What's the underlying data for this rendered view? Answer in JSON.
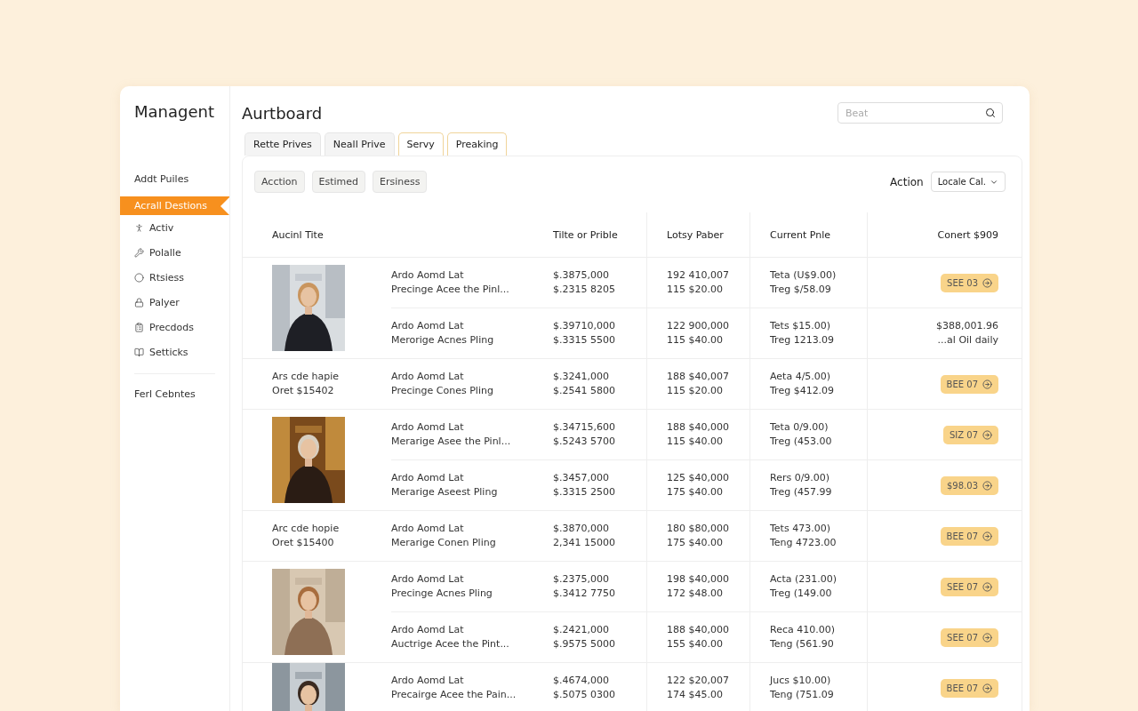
{
  "sidebar": {
    "title": "Managent",
    "items": [
      {
        "label": "Addt Puiles",
        "kind": "text",
        "selected": false
      },
      {
        "label": "Acrall Destions",
        "kind": "text",
        "selected": true
      },
      {
        "label": "Activ",
        "kind": "icon",
        "selected": false
      },
      {
        "label": "Polalle",
        "kind": "icon",
        "selected": false
      },
      {
        "label": "Rtsiess",
        "kind": "icon",
        "selected": false
      },
      {
        "label": "Palyer",
        "kind": "icon",
        "selected": false
      },
      {
        "label": "Precdods",
        "kind": "icon",
        "selected": false
      },
      {
        "label": "Setticks",
        "kind": "icon",
        "selected": false
      }
    ],
    "footer_items": [
      "Ferl Cebntes"
    ]
  },
  "header": {
    "title": "Aurtboard",
    "search": {
      "placeholder": "Beat"
    }
  },
  "tabs": [
    {
      "label": "Rette Prives",
      "selected": false
    },
    {
      "label": "Neall Prive",
      "selected": false
    },
    {
      "label": "Servy",
      "selected": true
    },
    {
      "label": "Preaking",
      "selected": true
    }
  ],
  "filters": [
    "Acction",
    "Estimed",
    "Ersiness"
  ],
  "action_label": "Action",
  "action_select": "Locale Cal.",
  "table": {
    "columns": [
      "Aucinl Tite",
      "Tilte or Prible",
      "Lotsy Paber",
      "Current Pnle",
      "Conert $909"
    ],
    "groups": [
      {
        "lot": {
          "kind": "picture"
        },
        "rows": [
          {
            "title": [
              "Ardo Aomd Lat",
              "Precinge Acee the Pinl..."
            ],
            "price": [
              "$.3875,000",
              "$.2315 8205"
            ],
            "lot_price": [
              "192 410,007",
              "115 $20.00"
            ],
            "current": [
              "Teta (U$9.00)",
              "Treg $/58.09"
            ],
            "action": {
              "kind": "button",
              "label": "SEE 03"
            }
          },
          {
            "title": [
              "Ardo Aomd Lat",
              "Merorige Acnes Pling"
            ],
            "price": [
              "$.39710,000",
              "$.3315 5500"
            ],
            "lot_price": [
              "122 900,000",
              "115 $40.00"
            ],
            "current": [
              "Tets $15.00)",
              "Treg 1213.09"
            ],
            "action": {
              "kind": "price",
              "lines": [
                "$388,001.96",
                "...al Oil daily"
              ]
            }
          }
        ]
      },
      {
        "lot": {
          "kind": "text",
          "lines": [
            "Ars cde hapie",
            "Oret $15402"
          ]
        },
        "rows": [
          {
            "title": [
              "Ardo Aomd Lat",
              "Precinge Cones Pling"
            ],
            "price": [
              "$.3241,000",
              "$.2541 5800"
            ],
            "lot_price": [
              "188 $40,007",
              "115 $20.00"
            ],
            "current": [
              "Aeta 4/5.00)",
              "Treg $412.09"
            ],
            "action": {
              "kind": "button",
              "label": "BEE 07"
            }
          }
        ]
      },
      {
        "lot": {
          "kind": "picture"
        },
        "rows": [
          {
            "title": [
              "Ardo Aomd Lat",
              "Merarige Asee the Pinl..."
            ],
            "price": [
              "$.34715,600",
              "$.5243 5700"
            ],
            "lot_price": [
              "188 $40,000",
              "115 $40.00"
            ],
            "current": [
              "Teta 0/9.00)",
              "Treg (453.00"
            ],
            "action": {
              "kind": "button",
              "label": "SIZ 07"
            }
          },
          {
            "title": [
              "Ardo Aomd Lat",
              "Merarige Aseest Pling"
            ],
            "price": [
              "$.3457,000",
              "$.3315 2500"
            ],
            "lot_price": [
              "125 $40,000",
              "175 $40.00"
            ],
            "current": [
              "Rers 0/9.00)",
              "Treg (457.99"
            ],
            "action": {
              "kind": "button",
              "label": "$98.03"
            }
          }
        ]
      },
      {
        "lot": {
          "kind": "text",
          "lines": [
            "Arc cde hopie",
            "Oret $15400"
          ]
        },
        "rows": [
          {
            "title": [
              "Ardo Aomd Lat",
              "Merarige Conen Pling"
            ],
            "price": [
              "$.3870,000",
              "2,341 15000"
            ],
            "lot_price": [
              "180 $80,000",
              "175 $40.00"
            ],
            "current": [
              "Tets 473.00)",
              "Teng 4723.00"
            ],
            "action": {
              "kind": "button",
              "label": "BEE 07"
            }
          }
        ]
      },
      {
        "lot": {
          "kind": "picture"
        },
        "rows": [
          {
            "title": [
              "Ardo Aomd Lat",
              "Precinge Acnes Pling"
            ],
            "price": [
              "$.2375,000",
              "$.3412 7750"
            ],
            "lot_price": [
              "198 $40,000",
              "172 $48.00"
            ],
            "current": [
              "Acta (231.00)",
              "Treg (149.00"
            ],
            "action": {
              "kind": "button",
              "label": "SEE 07"
            }
          },
          {
            "title": [
              "Ardo Aomd Lat",
              "Auctrige Acee the Pint..."
            ],
            "price": [
              "$.2421,000",
              "$.9575 5000"
            ],
            "lot_price": [
              "188 $40,000",
              "155 $40.00"
            ],
            "current": [
              "Reca 410.00)",
              "Teng (561.90"
            ],
            "action": {
              "kind": "button",
              "label": "SEE 07"
            }
          }
        ]
      },
      {
        "lot": {
          "kind": "picture"
        },
        "rows": [
          {
            "title": [
              "Ardo Aomd Lat",
              "Precairge Acee the Pain..."
            ],
            "price": [
              "$.4674,000",
              "$.5075 0300"
            ],
            "lot_price": [
              "122 $20,007",
              "174 $45.00"
            ],
            "current": [
              "Jucs $10.00)",
              "Teng (751.09"
            ],
            "action": {
              "kind": "button",
              "label": "BEE 07"
            }
          }
        ]
      }
    ]
  }
}
